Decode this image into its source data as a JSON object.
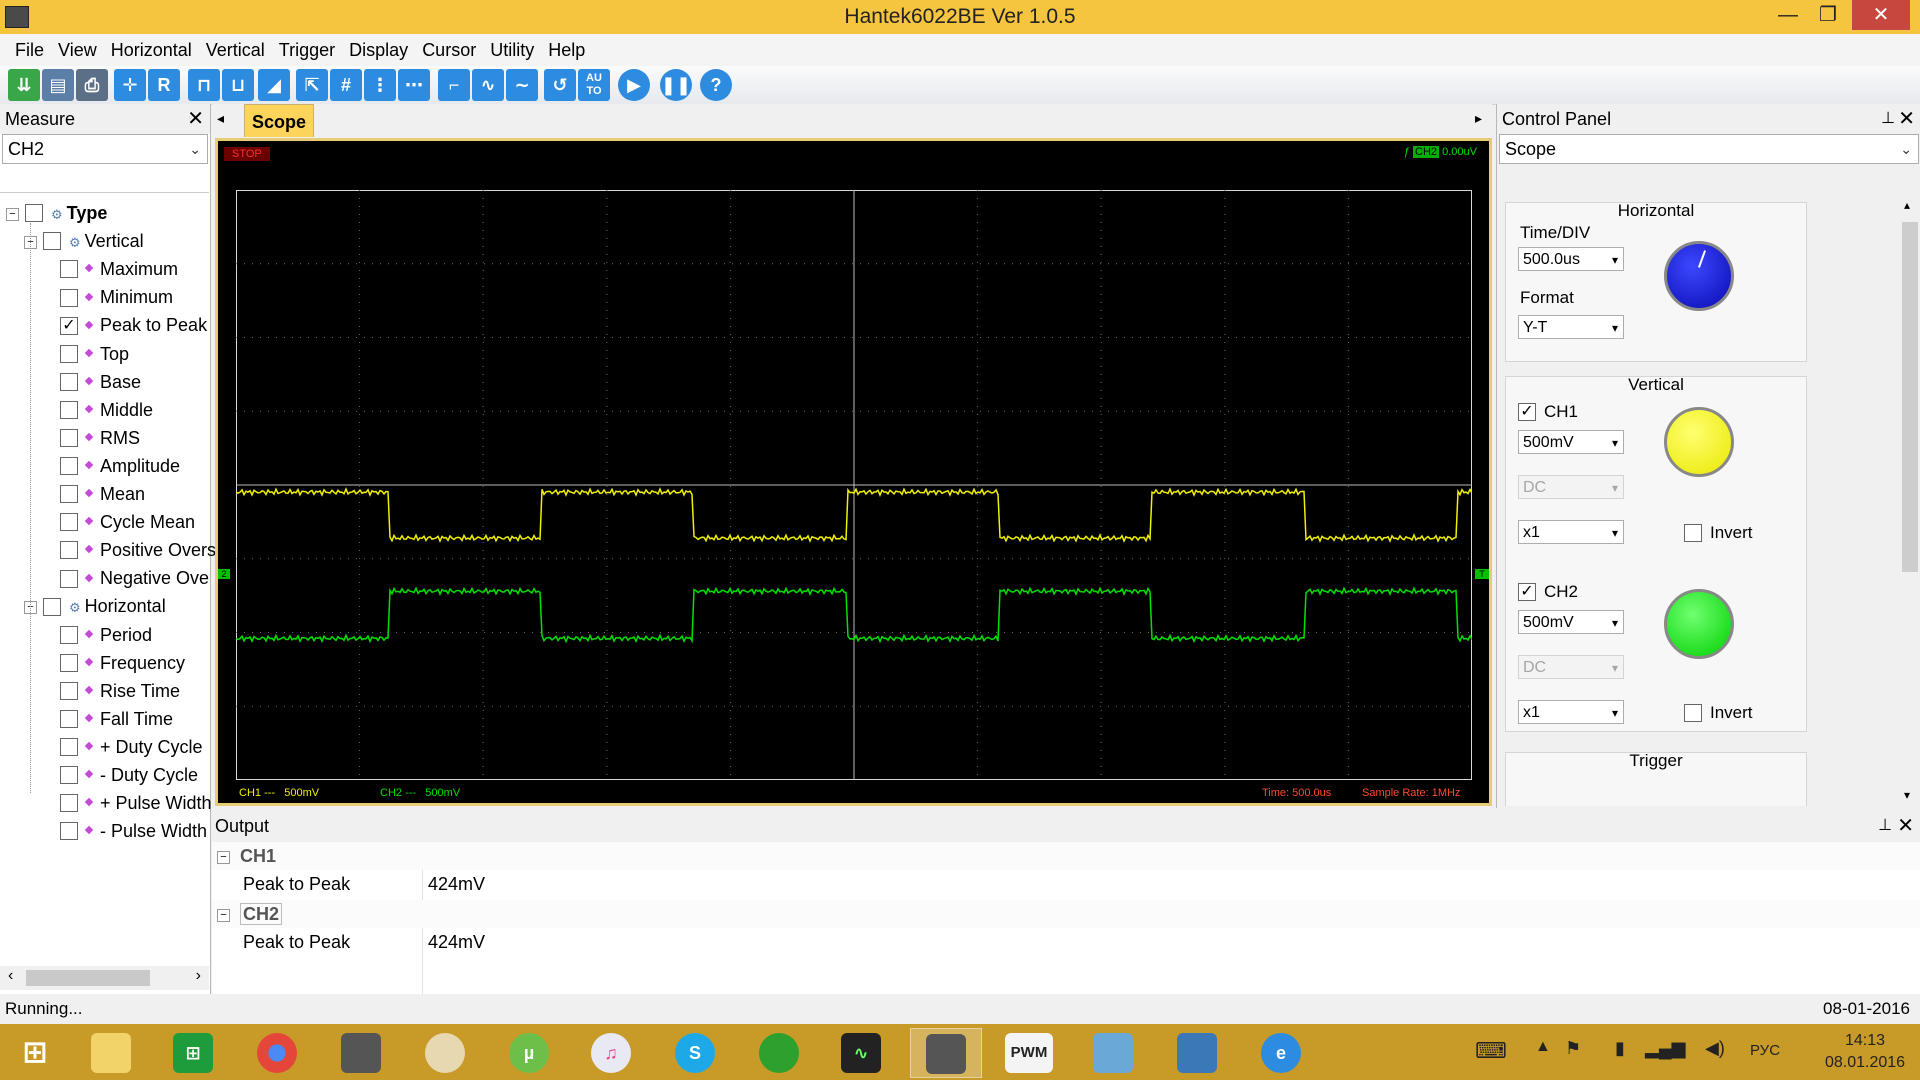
{
  "window": {
    "title": "Hantek6022BE Ver 1.0.5",
    "minimize": "—",
    "maximize": "❐",
    "close": "✕"
  },
  "menu": [
    "File",
    "View",
    "Horizontal",
    "Vertical",
    "Trigger",
    "Display",
    "Cursor",
    "Utility",
    "Help"
  ],
  "toolbar": {
    "icons": [
      "save-green-icon",
      "save-icon",
      "print-icon",
      "auto-scale-icon",
      "reset-icon",
      "pulse-icon",
      "pulse-measure-icon",
      "slope-icon",
      "cursor-icon",
      "grid-icon",
      "vertical-cursor-icon",
      "horizontal-cursor-icon",
      "step-icon",
      "wave-icon",
      "sine-icon",
      "undo-icon",
      "auto-icon",
      "run-icon",
      "pause-icon",
      "help-icon"
    ],
    "r_label": "R",
    "auto_label": "AU TO",
    "help_label": "?"
  },
  "measure": {
    "title": "Measure",
    "close": "✕",
    "channel": "CH2",
    "tree": [
      {
        "label": "Type",
        "level": 0,
        "bold": true,
        "checked": false
      },
      {
        "label": "Vertical",
        "level": 1,
        "checked": false
      },
      {
        "label": "Maximum",
        "level": 2,
        "checked": false
      },
      {
        "label": "Minimum",
        "level": 2,
        "checked": false
      },
      {
        "label": "Peak to Peak",
        "level": 2,
        "checked": true
      },
      {
        "label": "Top",
        "level": 2,
        "checked": false
      },
      {
        "label": "Base",
        "level": 2,
        "checked": false
      },
      {
        "label": "Middle",
        "level": 2,
        "checked": false
      },
      {
        "label": "RMS",
        "level": 2,
        "checked": false
      },
      {
        "label": "Amplitude",
        "level": 2,
        "checked": false
      },
      {
        "label": "Mean",
        "level": 2,
        "checked": false
      },
      {
        "label": "Cycle Mean",
        "level": 2,
        "checked": false
      },
      {
        "label": "Positive Overs",
        "level": 2,
        "checked": false
      },
      {
        "label": "Negative Ove",
        "level": 2,
        "checked": false
      },
      {
        "label": "Horizontal",
        "level": 1,
        "checked": false
      },
      {
        "label": "Period",
        "level": 2,
        "checked": false
      },
      {
        "label": "Frequency",
        "level": 2,
        "checked": false
      },
      {
        "label": "Rise Time",
        "level": 2,
        "checked": false
      },
      {
        "label": "Fall Time",
        "level": 2,
        "checked": false
      },
      {
        "label": "+ Duty Cycle",
        "level": 2,
        "checked": false
      },
      {
        "label": "- Duty Cycle",
        "level": 2,
        "checked": false
      },
      {
        "label": "+ Pulse Width",
        "level": 2,
        "checked": false
      },
      {
        "label": "- Pulse Width",
        "level": 2,
        "checked": false
      }
    ]
  },
  "scope": {
    "tab": "Scope",
    "state": "STOP",
    "trigger_channel": "CH2",
    "trigger_level": "0.00uV",
    "ch1_readout": "CH1",
    "ch1_coupling": "---",
    "ch1_scale": "500mV",
    "ch2_readout": "CH2",
    "ch2_coupling": "---",
    "ch2_scale": "500mV",
    "time": "Time: 500.0us",
    "sample_rate": "Sample Rate: 1MHz",
    "ch2_marker": "2",
    "trigger_marker": "T",
    "colors": {
      "ch1": "#f0f000",
      "ch2": "#00e000",
      "grid": "#6a6a6a",
      "screen": "#000000"
    }
  },
  "control_panel": {
    "title": "Control Panel",
    "pin": "⊥",
    "close": "✕",
    "mode": "Scope",
    "horizontal": {
      "title": "Horizontal",
      "timediv_label": "Time/DIV",
      "timediv": "500.0us",
      "format_label": "Format",
      "format": "Y-T"
    },
    "vertical": {
      "title": "Vertical",
      "ch1": {
        "label": "CH1",
        "checked": true,
        "volt": "500mV",
        "coupling": "DC",
        "probe": "x1",
        "invert": "Invert"
      },
      "ch2": {
        "label": "CH2",
        "checked": true,
        "volt": "500mV",
        "coupling": "DC",
        "probe": "x1",
        "invert": "Invert"
      }
    },
    "trigger": {
      "title": "Trigger"
    }
  },
  "output": {
    "title": "Output",
    "groups": [
      {
        "channel": "CH1",
        "name": "Peak to Peak",
        "value": "424mV"
      },
      {
        "channel": "CH2",
        "name": "Peak to Peak",
        "value": "424mV"
      }
    ]
  },
  "status": {
    "text": "Running...",
    "date": "08-01-2016"
  },
  "taskbar": {
    "apps": [
      "windows-start-icon",
      "file-explorer-icon",
      "store-icon",
      "chrome-icon",
      "scope-app-icon",
      "paint-icon",
      "utorrent-icon",
      "itunes-icon",
      "skype-icon",
      "green-app-icon",
      "oscilloscope-icon",
      "hantek-icon",
      "pwm-icon",
      "network-icon",
      "photo-icon",
      "ie-icon"
    ],
    "pwm_label": "PWM",
    "lang": "РУС",
    "time": "14:13",
    "date": "08.01.2016"
  }
}
